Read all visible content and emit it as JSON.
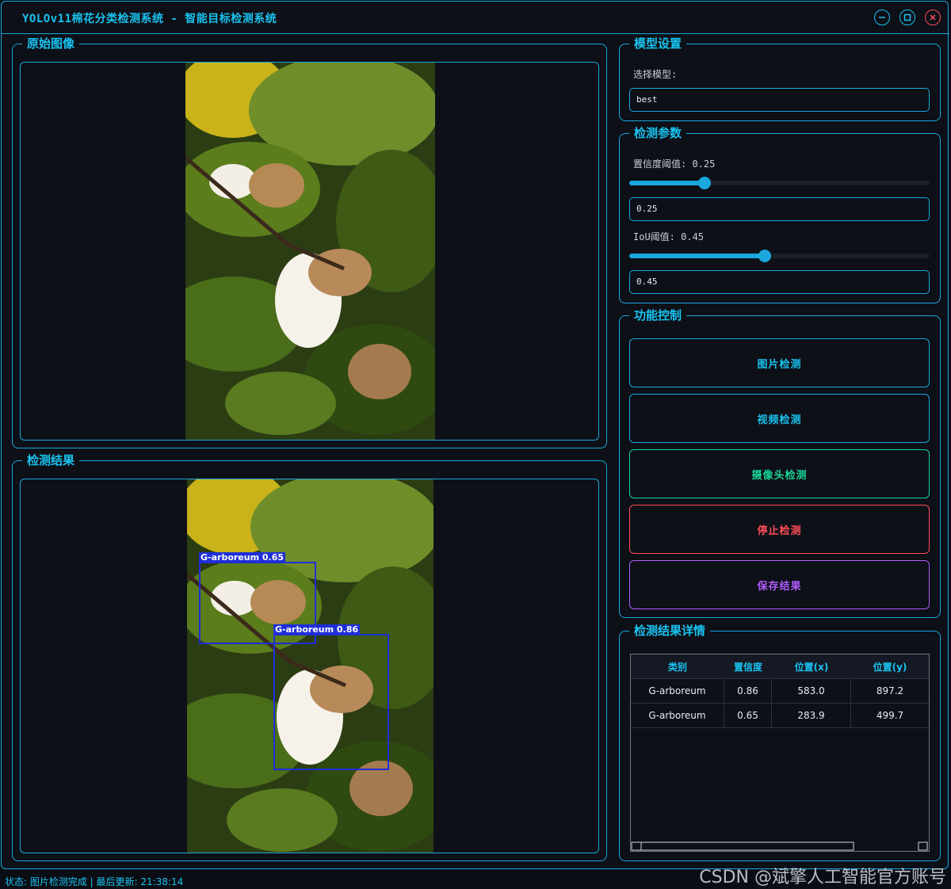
{
  "window": {
    "title": "YOLOv11棉花分类检测系统 - 智能目标检测系统"
  },
  "panels": {
    "original": {
      "title": "原始图像"
    },
    "result": {
      "title": "检测结果"
    },
    "model": {
      "title": "模型设置",
      "select_label": "选择模型:",
      "selected": "best"
    },
    "params": {
      "title": "检测参数",
      "conf_label": "置信度阈值: 0.25",
      "conf_value": "0.25",
      "conf": 0.25,
      "iou_label": "IoU阈值: 0.45",
      "iou_value": "0.45",
      "iou": 0.45
    },
    "controls": {
      "title": "功能控制",
      "buttons": [
        {
          "label": "图片检测",
          "color": "#19c3f0"
        },
        {
          "label": "视频检测",
          "color": "#19c3f0"
        },
        {
          "label": "摄像头检测",
          "color": "#19d49a"
        },
        {
          "label": "停止检测",
          "color": "#ff4d5a"
        },
        {
          "label": "保存结果",
          "color": "#b05cff"
        }
      ]
    },
    "details": {
      "title": "检测结果详情",
      "columns": [
        "类别",
        "置信度",
        "位置(x)",
        "位置(y)"
      ],
      "rows": [
        [
          "G-arboreum",
          "0.86",
          "583.0",
          "897.2"
        ],
        [
          "G-arboreum",
          "0.65",
          "283.9",
          "499.7"
        ]
      ]
    }
  },
  "detections": [
    {
      "label": "G-arboreum 0.65"
    },
    {
      "label": "G-arboreum 0.86"
    }
  ],
  "status": "状态: 图片检测完成 | 最后更新: 21:38:14",
  "watermark": "CSDN @斌擎人工智能官方账号",
  "colors": {
    "accent": "#1aa7dd",
    "box": "#1e2fd8"
  }
}
